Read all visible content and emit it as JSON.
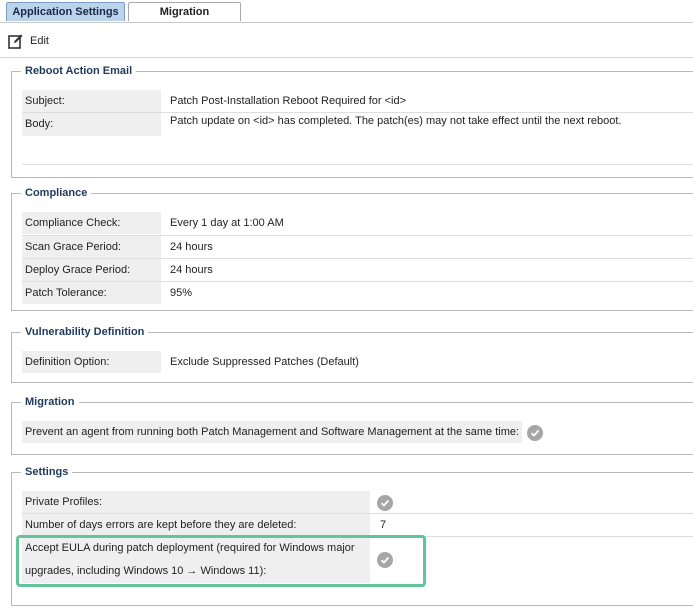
{
  "tabs": [
    {
      "label": "Application Settings",
      "active": true
    },
    {
      "label": "Migration",
      "active": false
    }
  ],
  "toolbar": {
    "edit_label": "Edit",
    "edit_icon": "edit-icon"
  },
  "reboot_email": {
    "title": "Reboot Action Email",
    "subject_label": "Subject:",
    "subject_value": "Patch Post-Installation Reboot Required for <id>",
    "body_label": "Body:",
    "body_value": "Patch update on <id> has completed. The patch(es) may not take effect until the next reboot."
  },
  "compliance": {
    "title": "Compliance",
    "rows": [
      {
        "label": "Compliance Check:",
        "value": "Every 1 day at 1:00 AM"
      },
      {
        "label": "Scan Grace Period:",
        "value": "24 hours"
      },
      {
        "label": "Deploy Grace Period:",
        "value": "24 hours"
      },
      {
        "label": "Patch Tolerance:",
        "value": "95%"
      }
    ]
  },
  "vulnerability": {
    "title": "Vulnerability Definition",
    "label": "Definition Option:",
    "value": "Exclude Suppressed Patches (Default)"
  },
  "migration": {
    "title": "Migration",
    "label": "Prevent an agent from running both Patch Management and Software Management at the same time:",
    "enabled": true
  },
  "settings": {
    "title": "Settings",
    "private_profiles_label": "Private Profiles:",
    "private_profiles_enabled": true,
    "days_errors_label": "Number of days errors are kept before they are deleted:",
    "days_errors_value": "7",
    "eula_label_line1": "Accept EULA during patch deployment (required for Windows major",
    "eula_label_line2": "upgrades, including Windows 10 → Windows 11):",
    "eula_enabled": true
  },
  "colors": {
    "active_tab": "#bcd3ec",
    "legend_text": "#1f3a5c",
    "check_gray": "#a6a6a6",
    "highlight_green": "#62c49a"
  }
}
